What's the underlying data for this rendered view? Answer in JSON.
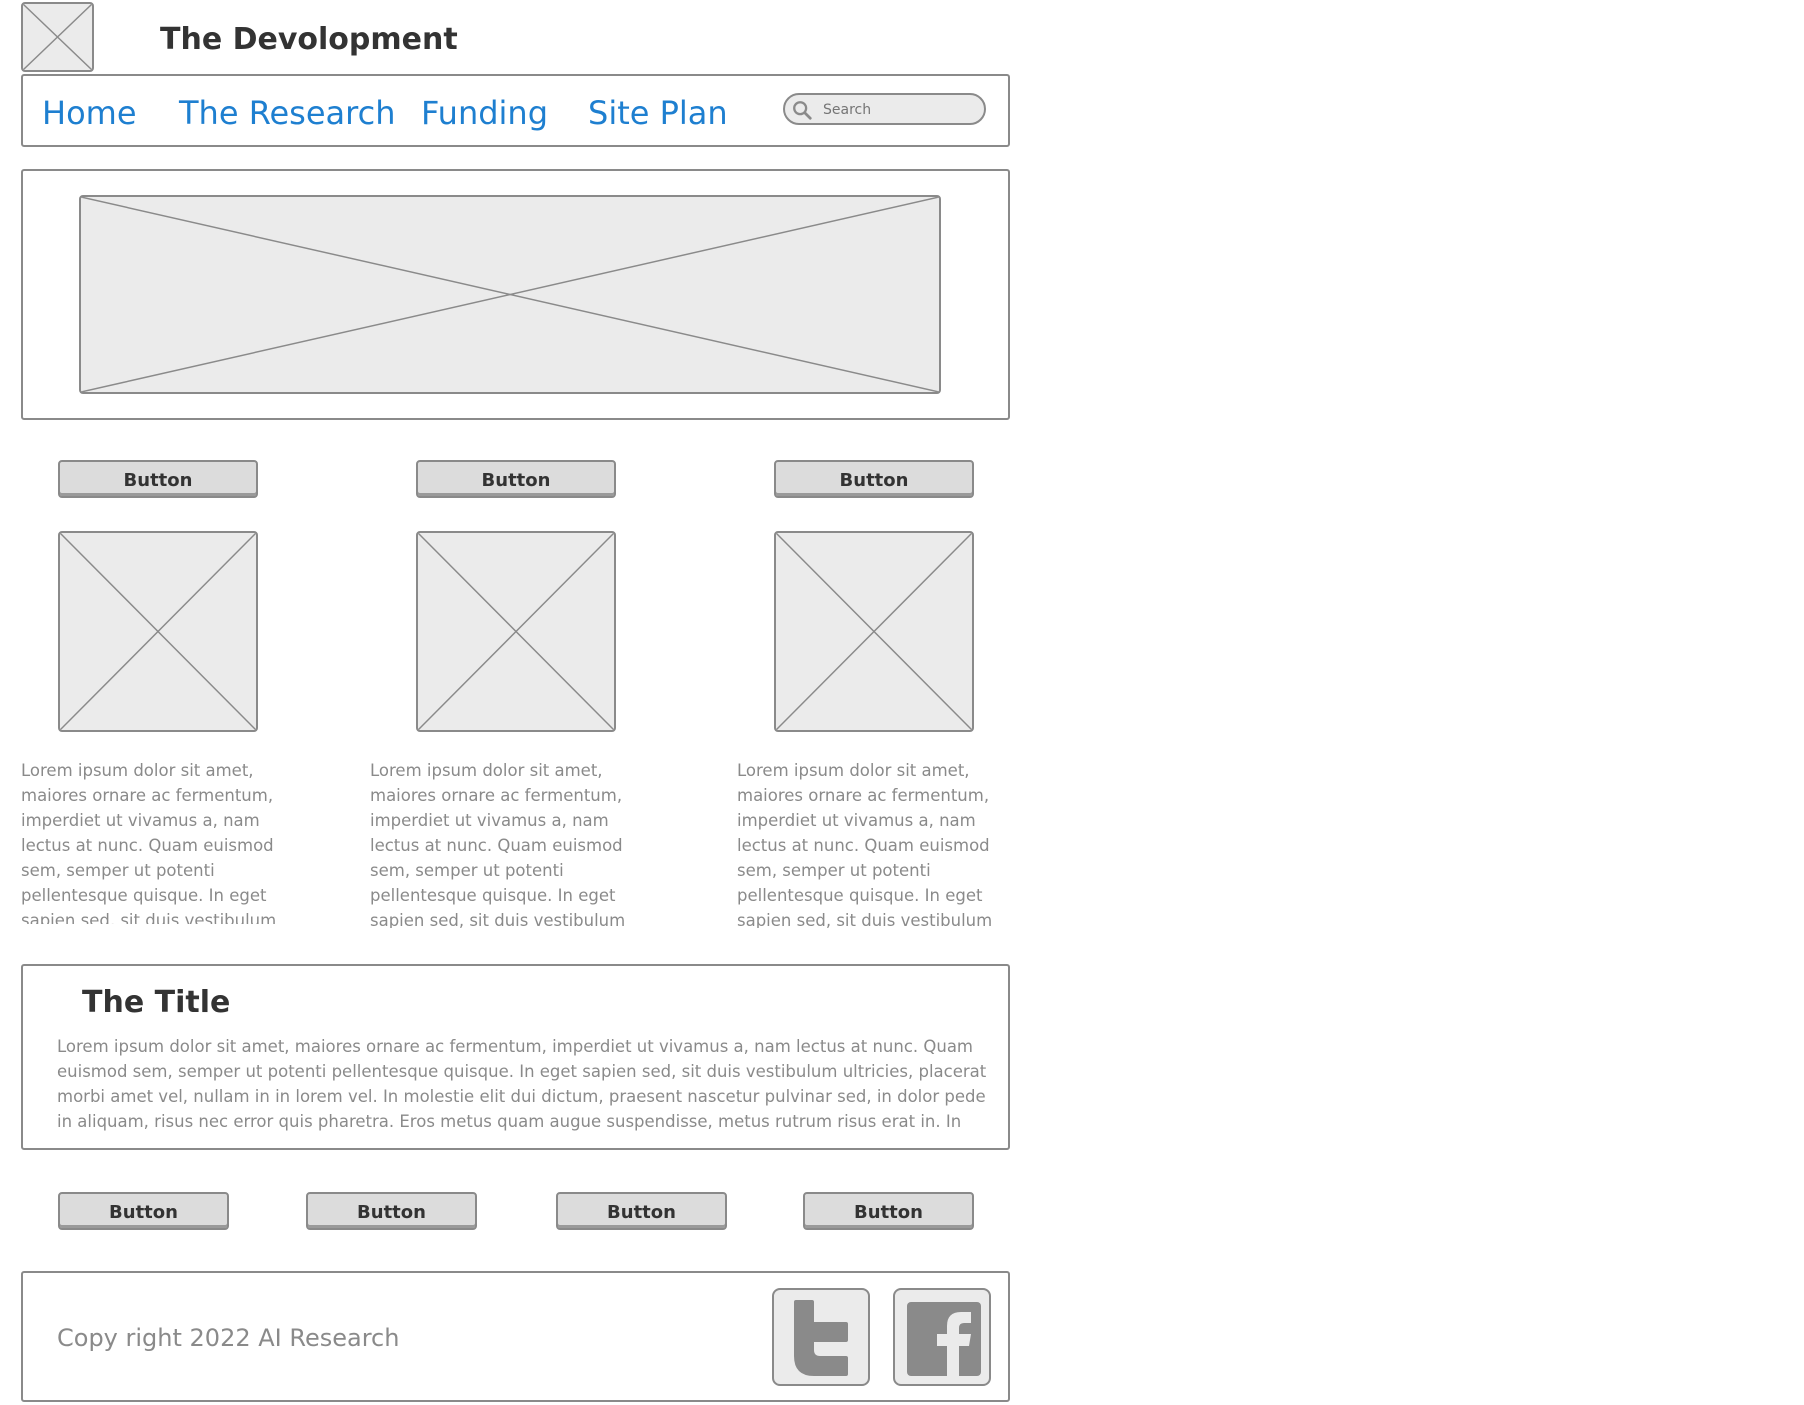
{
  "header": {
    "logo_icon": "image-placeholder-icon",
    "title": "The Devolopment"
  },
  "nav": {
    "items": [
      {
        "label": "Home"
      },
      {
        "label": "The Research"
      },
      {
        "label": "Funding"
      },
      {
        "label": "Site Plan"
      }
    ],
    "search": {
      "placeholder": "Search",
      "icon": "search-icon"
    }
  },
  "hero": {
    "image_icon": "image-placeholder-icon"
  },
  "columns": [
    {
      "button_label": "Button",
      "image_icon": "image-placeholder-icon",
      "text": "Lorem ipsum dolor sit amet, maiores ornare ac fermentum, imperdiet ut vivamus a, nam lectus at nunc. Quam euismod sem, semper ut potenti pellentesque quisque. In eget sapien sed, sit duis vestibulum ultricies, placerat morbi amet vel, nullam in in"
    },
    {
      "button_label": "Button",
      "image_icon": "image-placeholder-icon",
      "text": "Lorem ipsum dolor sit amet, maiores ornare ac fermentum, imperdiet ut vivamus a, nam lectus at nunc. Quam euismod sem, semper ut potenti pellentesque quisque. In eget sapien sed, sit duis vestibulum ultricies, placerat morbi amet vel, nullam in in"
    },
    {
      "button_label": "Button",
      "image_icon": "image-placeholder-icon",
      "text": "Lorem ipsum dolor sit amet, maiores ornare ac fermentum, imperdiet ut vivamus a, nam lectus at nunc. Quam euismod sem, semper ut potenti pellentesque quisque. In eget sapien sed, sit duis vestibulum ultricies, placerat morbi amet vel, nullam in in"
    }
  ],
  "article": {
    "title": "The Title",
    "body": "Lorem ipsum dolor sit amet, maiores ornare ac fermentum, imperdiet ut vivamus a, nam lectus at nunc. Quam euismod sem, semper ut potenti pellentesque quisque. In eget sapien sed, sit duis vestibulum ultricies, placerat morbi amet vel, nullam in in lorem vel. In molestie elit dui dictum, praesent nascetur pulvinar sed, in dolor pede in aliquam, risus nec error quis pharetra. Eros metus quam augue suspendisse, metus rutrum risus erat in.  In ultrices quo ut lectus, etiam vestibulum urna a est,"
  },
  "bottom_buttons": [
    "Button",
    "Button",
    "Button",
    "Button"
  ],
  "footer": {
    "copyright": "Copy right 2022 AI Research",
    "social": [
      {
        "icon": "twitter-icon"
      },
      {
        "icon": "facebook-icon"
      }
    ]
  },
  "colors": {
    "link": "#1e7fd0",
    "border": "#8a8a8a",
    "placeholder_fill": "#ebebeb",
    "muted_text": "#8a8a8a"
  }
}
